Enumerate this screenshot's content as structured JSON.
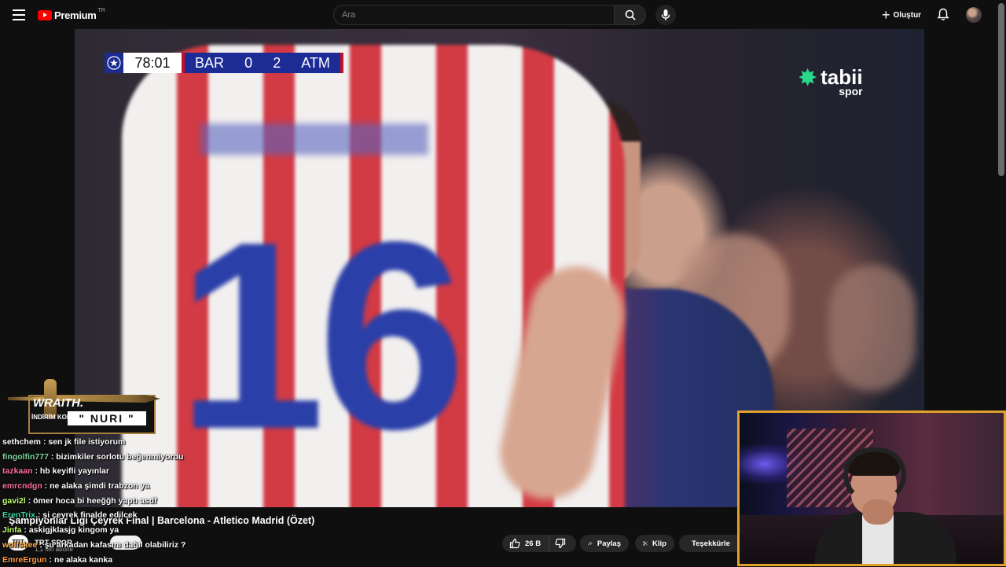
{
  "header": {
    "logo_text": "Premium",
    "logo_sup": "TR",
    "search_placeholder": "Ara",
    "create_label": "Oluştur"
  },
  "video": {
    "scorebug": {
      "clock": "78:01",
      "home": "BAR",
      "home_score": "0",
      "away_score": "2",
      "away": "ATM"
    },
    "jersey_number": "16",
    "broadcaster": {
      "name": "tabii",
      "sub": "spor"
    }
  },
  "overlay": {
    "sponsor_title": "WRAITH.",
    "sponsor_code_label": "İNDİRİM KODU:",
    "sponsor_code": "\" NURI \""
  },
  "chat": [
    {
      "nick": "sethchem",
      "color": "#ffffff",
      "msg": ": sen jk file istiyorum"
    },
    {
      "nick": "fingolfin777",
      "color": "#7fd6a0",
      "msg": ": bizimkiler sorlotu beğenmiyordu"
    },
    {
      "nick": "tazkaan",
      "color": "#ff6ea0",
      "msg": ": hb keyifli yayınlar"
    },
    {
      "nick": "emrcndgn",
      "color": "#ff6ea0",
      "msg": ": ne alaka şimdi trabzon ya"
    },
    {
      "nick": "gavi2l",
      "color": "#c0ff70",
      "msg": ": ömer hoca bi heeğğh yaptı asdf"
    },
    {
      "nick": "ErenTrix",
      "color": "#3ad6a8",
      "msg": ": şi çeyrek finalde edilcek"
    },
    {
      "nick": "Jinfa",
      "color": "#c0ff70",
      "msg": ": askigjklasjg kingom ya"
    },
    {
      "nick": "wolfskee",
      "color": "#ffb04a",
      "msg": ": şu arkadan kafasını dağıl olabiliriz ?"
    },
    {
      "nick": "EmreErgun",
      "color": "#ff9a4a",
      "msg": ": ne alaka kanka"
    }
  ],
  "info": {
    "title": "Şampiyonlar Ligi Çeyrek Final | Barcelona - Atletico Madrid (Özet)",
    "channel_avatar": "TRT",
    "channel_name": "TRT SPOR",
    "channel_subs": "1,1 Mn abone"
  },
  "actions": {
    "likes": "26 B",
    "share": "Paylaş",
    "clip": "Klip",
    "thanks": "Teşekkürle"
  },
  "icons": [
    "menu-icon",
    "youtube-logo-icon",
    "search-icon",
    "mic-icon",
    "plus-icon",
    "bell-icon",
    "like-icon",
    "dislike-icon",
    "share-icon",
    "scissors-icon",
    "thanks-icon"
  ]
}
